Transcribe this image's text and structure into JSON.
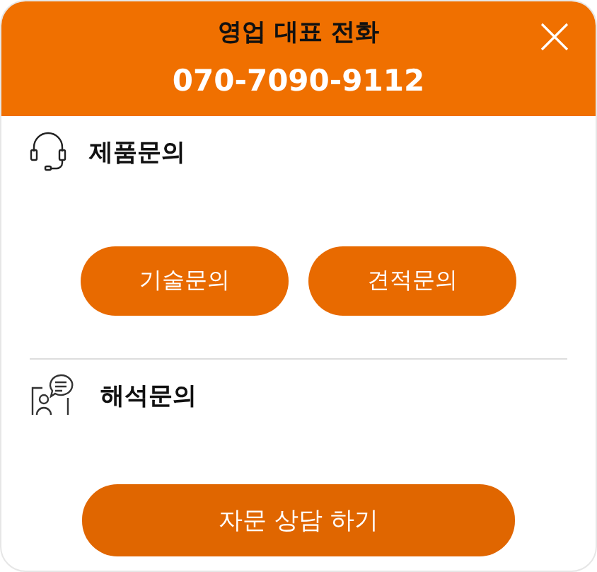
{
  "header": {
    "title": "영업 대표 전화",
    "phone": "070-7090-9112"
  },
  "sections": [
    {
      "kind": "headset",
      "title": "제품문의",
      "buttons": [
        "기술문의",
        "견적문의"
      ]
    },
    {
      "kind": "chat",
      "title": "해석문의",
      "buttons": [
        "자문 상담 하기"
      ]
    }
  ]
}
